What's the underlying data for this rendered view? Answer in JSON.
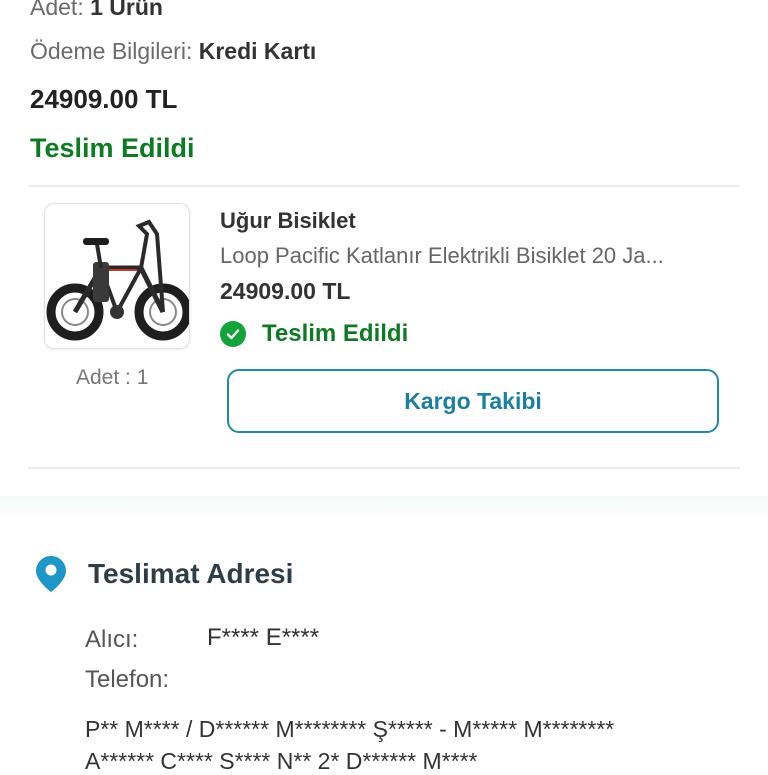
{
  "order_summary": {
    "quantity_label": "Adet:",
    "quantity_value": "1 Ürün",
    "payment_label": "Ödeme Bilgileri:",
    "payment_value": "Kredi Kartı",
    "total": "24909.00 TL",
    "status": "Teslim Edildi"
  },
  "product": {
    "image_icon": "bicycle-image",
    "seller": "Uğur Bisiklet",
    "name": "Loop Pacific Katlanır Elektrikli Bisiklet 20 Ja...",
    "price": "24909.00 TL",
    "status": "Teslim Edildi",
    "status_icon": "check-circle-icon",
    "quantity": "Adet : 1",
    "track_button": "Kargo Takibi"
  },
  "address": {
    "title": "Teslimat Adresi",
    "icon": "location-pin-icon",
    "recipient_label": "Alıcı:",
    "recipient_value": "F**** E****",
    "phone_label": "Telefon:",
    "phone_value": "",
    "line1": "P** M**** / D****** M******** Ş***** - M***** M********",
    "line2": "A****** C**** S**** N** 2* D****** M****"
  },
  "colors": {
    "success_green": "#0f7a24",
    "check_green": "#12a33a",
    "accent_teal": "#1f8aa8",
    "pin_blue": "#1e96c8"
  }
}
